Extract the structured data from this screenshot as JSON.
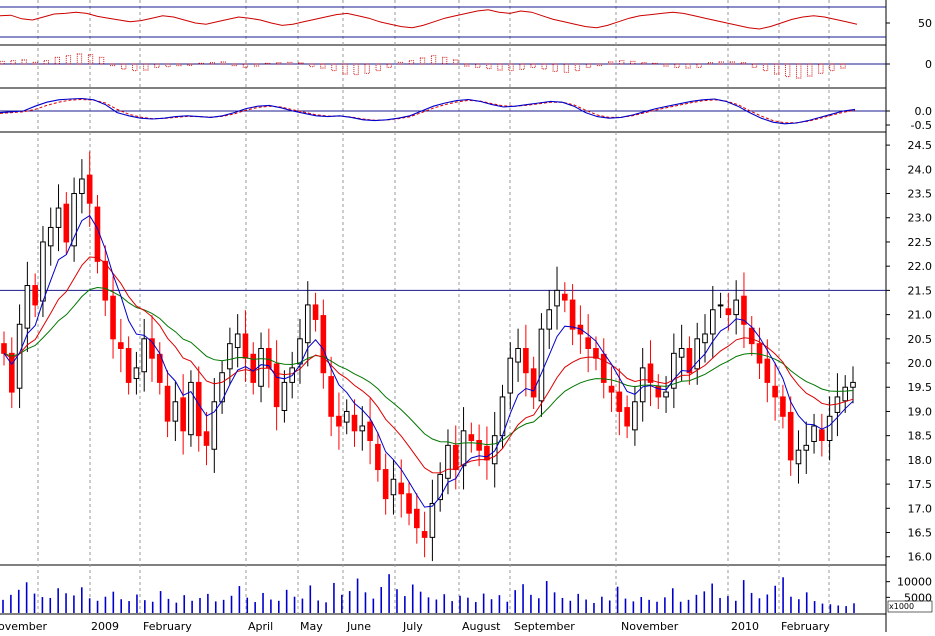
{
  "chart_data": {
    "type": "candlestick",
    "source_hint": "stock price chart with indicator panes (oscillator, histogram, MACD), price pane with moving averages, volume pane",
    "colors": {
      "up_candle": "#000000",
      "down_candle": "#ff0000",
      "ma_short": "#0000cc",
      "ma_mid": "#dd0000",
      "ma_long": "#007700",
      "pane_line": "#1a1a8c",
      "volume": "#0000cc",
      "grid": "#9a9a9a",
      "oscillator": "#cc0000",
      "histogram": "#cc0000"
    },
    "x_axis_labels": [
      "ovember",
      "2009",
      "February",
      "April",
      "May",
      "June",
      "July",
      "August",
      "September",
      "November",
      "2010",
      "February"
    ],
    "panes": {
      "oscillator": {
        "tick_labels": [
          "50"
        ],
        "reference_levels": [
          70,
          30
        ],
        "ylim": [
          15,
          85
        ],
        "values": [
          62,
          63,
          57,
          55,
          60,
          65,
          66,
          68,
          66,
          61,
          58,
          55,
          52,
          54,
          58,
          62,
          60,
          55,
          50,
          48,
          52,
          56,
          60,
          58,
          55,
          50,
          46,
          48,
          52,
          56,
          60,
          64,
          66,
          62,
          58,
          52,
          48,
          44,
          42,
          46,
          52,
          58,
          62,
          66,
          70,
          72,
          68,
          66,
          70,
          68,
          62,
          56,
          52,
          48,
          44,
          42,
          46,
          52,
          58,
          62,
          64,
          66,
          68,
          66,
          62,
          58,
          54,
          50,
          46,
          42,
          40,
          44,
          50,
          56,
          60,
          62,
          60,
          56,
          52,
          48
        ]
      },
      "histogram": {
        "tick_labels": [
          "0"
        ],
        "ylim": [
          -0.6,
          0.6
        ],
        "values": [
          0.08,
          0.1,
          0.12,
          0.05,
          0.1,
          0.2,
          0.25,
          0.3,
          0.28,
          0.2,
          -0.05,
          -0.15,
          -0.2,
          -0.18,
          -0.1,
          -0.08,
          -0.05,
          -0.04,
          0.02,
          0.04,
          0.06,
          -0.05,
          -0.1,
          -0.06,
          0.02,
          0.04,
          0.05,
          0.03,
          -0.08,
          -0.12,
          -0.2,
          -0.3,
          -0.32,
          -0.28,
          -0.2,
          -0.1,
          0.05,
          0.1,
          0.18,
          0.25,
          0.2,
          0.12,
          -0.06,
          -0.1,
          -0.14,
          -0.18,
          -0.2,
          -0.16,
          -0.1,
          -0.15,
          -0.22,
          -0.25,
          -0.2,
          -0.1,
          -0.05,
          0.06,
          0.1,
          0.08,
          0.04,
          0.02,
          -0.06,
          -0.1,
          -0.12,
          -0.1,
          0.04,
          0.06,
          0.06,
          0.04,
          -0.1,
          -0.2,
          -0.3,
          -0.38,
          -0.42,
          -0.36,
          -0.28,
          -0.2,
          -0.12
        ]
      },
      "macd": {
        "tick_labels": [
          "0.0",
          "-0.5"
        ],
        "ylim": [
          -1.2,
          1.2
        ],
        "line": [
          -0.1,
          -0.05,
          0.0,
          0.3,
          0.55,
          0.7,
          0.75,
          0.78,
          0.7,
          0.4,
          -0.1,
          -0.3,
          -0.45,
          -0.5,
          -0.45,
          -0.35,
          -0.3,
          -0.35,
          -0.4,
          -0.3,
          -0.1,
          0.15,
          0.3,
          0.35,
          0.2,
          0.0,
          -0.15,
          -0.3,
          -0.35,
          -0.3,
          -0.4,
          -0.55,
          -0.6,
          -0.55,
          -0.45,
          -0.3,
          0.0,
          0.3,
          0.5,
          0.65,
          0.72,
          0.6,
          0.4,
          0.25,
          0.3,
          0.4,
          0.5,
          0.6,
          0.55,
          0.3,
          -0.1,
          -0.35,
          -0.45,
          -0.4,
          -0.25,
          -0.05,
          0.15,
          0.3,
          0.45,
          0.6,
          0.7,
          0.75,
          0.6,
          0.3,
          -0.1,
          -0.45,
          -0.7,
          -0.8,
          -0.75,
          -0.6,
          -0.4,
          -0.2,
          0.0,
          0.1
        ],
        "signal": [
          -0.15,
          -0.1,
          -0.05,
          0.1,
          0.35,
          0.55,
          0.68,
          0.72,
          0.68,
          0.5,
          0.1,
          -0.2,
          -0.38,
          -0.48,
          -0.46,
          -0.4,
          -0.34,
          -0.35,
          -0.38,
          -0.34,
          -0.18,
          0.05,
          0.22,
          0.3,
          0.25,
          0.08,
          -0.08,
          -0.24,
          -0.32,
          -0.32,
          -0.38,
          -0.5,
          -0.58,
          -0.56,
          -0.48,
          -0.36,
          -0.1,
          0.18,
          0.4,
          0.56,
          0.66,
          0.62,
          0.46,
          0.32,
          0.3,
          0.36,
          0.45,
          0.55,
          0.55,
          0.38,
          0.05,
          -0.25,
          -0.4,
          -0.4,
          -0.3,
          -0.12,
          0.06,
          0.22,
          0.36,
          0.52,
          0.64,
          0.7,
          0.62,
          0.4,
          0.02,
          -0.32,
          -0.6,
          -0.74,
          -0.74,
          -0.64,
          -0.46,
          -0.26,
          -0.08,
          0.05
        ]
      },
      "price": {
        "tick_labels": [
          "24.5",
          "24.0",
          "23.5",
          "23.0",
          "22.5",
          "22.0",
          "21.5",
          "21.0",
          "20.5",
          "20.0",
          "19.5",
          "19.0",
          "18.5",
          "18.0",
          "17.5",
          "17.0",
          "16.5",
          "16.0"
        ],
        "ylim": [
          15.85,
          24.75
        ],
        "horizontal_reference": 21.5,
        "close": [
          20.2,
          19.4,
          20.8,
          21.6,
          21.2,
          22.5,
          22.8,
          23.2,
          22.5,
          23.5,
          23.8,
          23.3,
          22.1,
          21.3,
          20.5,
          20.3,
          19.6,
          19.9,
          20.5,
          20.1,
          19.6,
          18.8,
          19.2,
          18.6,
          19.6,
          18.5,
          18.3,
          19.2,
          19.8,
          20.4,
          20.6,
          20.1,
          19.6,
          20.3,
          19.9,
          19.1,
          19.6,
          19.9,
          20.5,
          21.2,
          20.9,
          19.8,
          18.9,
          18.7,
          19.0,
          18.6,
          18.7,
          18.4,
          17.8,
          17.2,
          17.6,
          17.3,
          16.9,
          16.6,
          16.4,
          17.1,
          17.7,
          18.3,
          17.8,
          18.6,
          18.4,
          18.2,
          18.0,
          18.5,
          19.3,
          20.1,
          20.3,
          19.8,
          19.3,
          20.7,
          21.1,
          21.5,
          21.3,
          20.7,
          20.6,
          20.3,
          20.1,
          19.6,
          19.4,
          19.0,
          18.7,
          19.2,
          19.9,
          19.6,
          19.3,
          19.4,
          20.2,
          20.3,
          19.8,
          20.5,
          20.6,
          21.1,
          21.2,
          21.0,
          21.3,
          20.8,
          20.4,
          20.0,
          19.6,
          19.3,
          18.9,
          18.0,
          18.2,
          18.3,
          18.7,
          18.4,
          18.9,
          19.3,
          19.5,
          19.6
        ]
      },
      "volume": {
        "tick_labels": [
          "10000",
          "5000"
        ],
        "unit_label": "x1000",
        "ylim": [
          0,
          15000
        ],
        "values": [
          4200,
          5800,
          7400,
          9800,
          6200,
          5100,
          4800,
          7900,
          6300,
          5600,
          8200,
          4700,
          3900,
          5200,
          6800,
          4400,
          3800,
          5900,
          4100,
          3600,
          7000,
          4500,
          3300,
          5700,
          3900,
          4800,
          6100,
          3700,
          4200,
          5500,
          8600,
          4900,
          3500,
          6400,
          4300,
          3900,
          7400,
          5200,
          4600,
          8800,
          4000,
          3400,
          9600,
          5800,
          7000,
          11000,
          6600,
          4600,
          8300,
          12400,
          7600,
          5400,
          9100,
          6800,
          5000,
          4300,
          6000,
          3800,
          5500,
          4900,
          3500,
          6200,
          4400,
          5700,
          3600,
          7300,
          9200,
          5800,
          4700,
          10200,
          6600,
          4800,
          3900,
          6100,
          4300,
          3200,
          5200,
          4000,
          8400,
          4600,
          3700,
          5100,
          4200,
          3600,
          5000,
          7900,
          3600,
          4200,
          5800,
          6900,
          9400,
          4800,
          5400,
          3900,
          10500,
          6400,
          4700,
          5900,
          8700,
          11400,
          5200,
          4400,
          6600,
          3800,
          3000,
          2800,
          2400,
          2200,
          3100
        ]
      }
    }
  }
}
